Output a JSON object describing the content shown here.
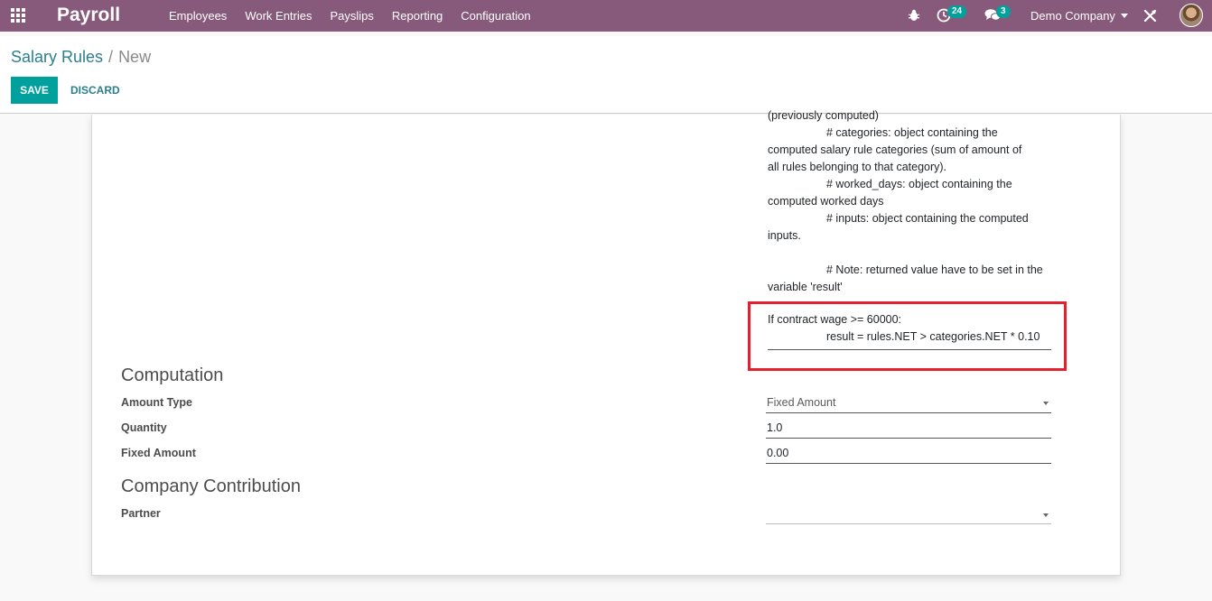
{
  "navbar": {
    "brand": "Payroll",
    "menu": [
      "Employees",
      "Work Entries",
      "Payslips",
      "Reporting",
      "Configuration"
    ],
    "activity_count": "24",
    "message_count": "3",
    "company": "Demo Company"
  },
  "breadcrumb": {
    "parent": "Salary Rules",
    "separator": "/",
    "current": "New"
  },
  "buttons": {
    "save": "SAVE",
    "discard": "DISCARD"
  },
  "help_text": [
    {
      "text": "(previously computed)",
      "indent": false
    },
    {
      "text": "# categories: object containing the",
      "indent": true
    },
    {
      "text": "computed salary rule categories (sum of amount of",
      "indent": false
    },
    {
      "text": "all rules belonging to that category).",
      "indent": false
    },
    {
      "text": "# worked_days: object containing the",
      "indent": true
    },
    {
      "text": "computed worked days",
      "indent": false
    },
    {
      "text": "# inputs: object containing the computed",
      "indent": true
    },
    {
      "text": "inputs.",
      "indent": false
    },
    {
      "text": "",
      "indent": false
    },
    {
      "text": "# Note: returned value have to be set in the",
      "indent": true
    },
    {
      "text": "variable 'result'",
      "indent": false
    }
  ],
  "code_input": {
    "line1": "If contract wage >= 60000:",
    "line2": "result = rules.NET > categories.NET * 0.10"
  },
  "computation": {
    "title": "Computation",
    "amount_type_label": "Amount Type",
    "amount_type_value": "Fixed Amount",
    "quantity_label": "Quantity",
    "quantity_value": "1.0",
    "fixed_amount_label": "Fixed Amount",
    "fixed_amount_value": "0.00"
  },
  "company_contribution": {
    "title": "Company Contribution",
    "partner_label": "Partner",
    "partner_value": ""
  },
  "colors": {
    "navbar": "#875a7b",
    "primary": "#00a09d",
    "link": "#2a7f8f",
    "highlight": "#e3202e"
  }
}
